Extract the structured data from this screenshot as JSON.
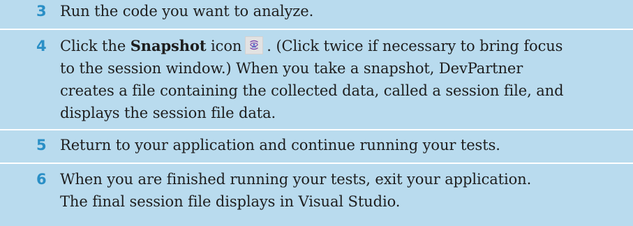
{
  "steps": [
    {
      "number": "3",
      "text": "Run the code you want to analyze."
    },
    {
      "number": "4",
      "line1_before": "Click the ",
      "line1_bold": "Snapshot",
      "line1_mid": " icon",
      "line1_after": ". (Click twice if necessary to bring focus",
      "line2": "to the session window.) When you take a snapshot, DevPartner",
      "line3": "creates a file containing the collected data, called a session file, and",
      "line4": "displays the session file data."
    },
    {
      "number": "5",
      "text": "Return to your application and continue running your tests."
    },
    {
      "number": "6",
      "line1": "When you are finished running your tests, exit your application.",
      "line2": "The final session file displays in Visual Studio."
    }
  ],
  "icons": {
    "snapshot": "snapshot-icon"
  },
  "colors": {
    "background": "#b9dbee",
    "divider": "#ffffff",
    "step_number": "#2a8fc6",
    "text": "#1e1e1e"
  }
}
